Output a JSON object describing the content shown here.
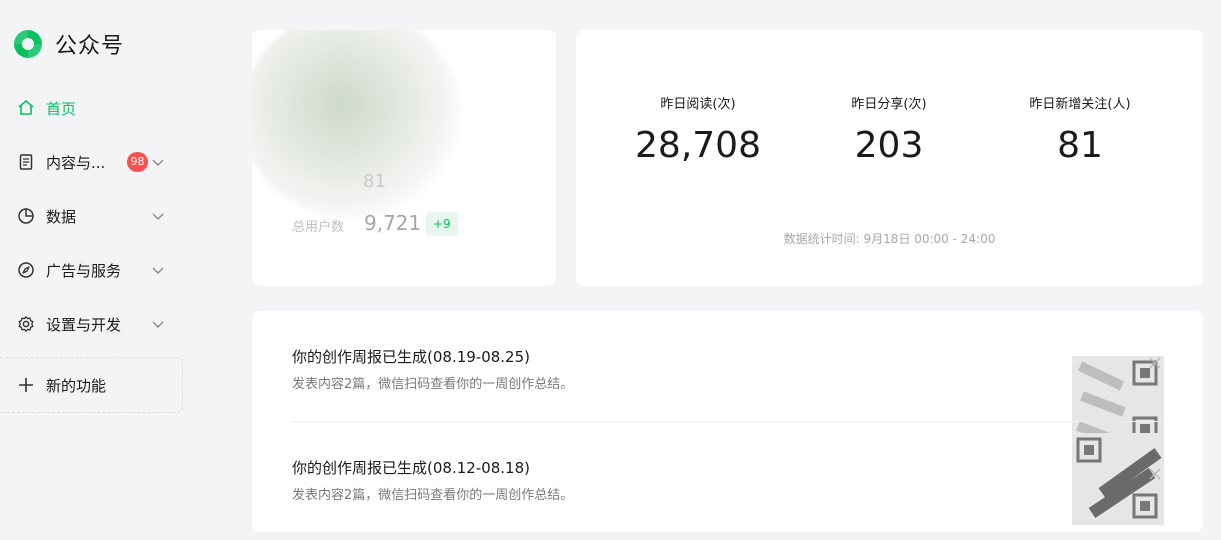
{
  "app": {
    "title": "公众号",
    "brand_color": "#07c160"
  },
  "sidebar": {
    "items": [
      {
        "label": "首页",
        "icon": "home-icon",
        "active": true
      },
      {
        "label": "内容与...",
        "icon": "document-icon",
        "badge": "98"
      },
      {
        "label": "数据",
        "icon": "pie-chart-icon"
      },
      {
        "label": "广告与服务",
        "icon": "compass-icon"
      },
      {
        "label": "设置与开发",
        "icon": "gear-icon"
      }
    ],
    "new_feature": {
      "label": "新的功能",
      "icon": "plus-icon"
    }
  },
  "account_card": {
    "faded_value": "81",
    "total_users_label": "总用户数",
    "total_users_value": "9,721",
    "total_users_delta": "+9"
  },
  "stats": {
    "items": [
      {
        "label": "昨日阅读(次)",
        "value": "28,708"
      },
      {
        "label": "昨日分享(次)",
        "value": "203"
      },
      {
        "label": "昨日新增关注(人)",
        "value": "81"
      }
    ],
    "time_note": "数据统计时间: 9月18日 00:00 - 24:00"
  },
  "notices": [
    {
      "title": "你的创作周报已生成(08.19-08.25)",
      "desc": "发表内容2篇，微信扫码查看你的一周创作总结。"
    },
    {
      "title": "你的创作周报已生成(08.12-08.18)",
      "desc": "发表内容2篇，微信扫码查看你的一周创作总结。"
    }
  ]
}
